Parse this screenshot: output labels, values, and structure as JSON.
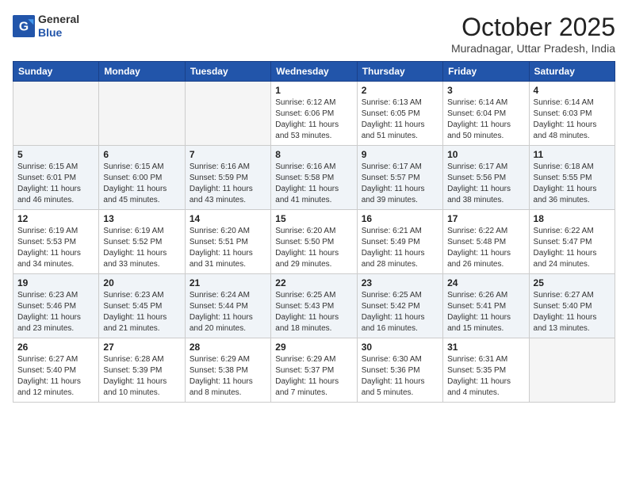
{
  "header": {
    "logo_general": "General",
    "logo_blue": "Blue",
    "month": "October 2025",
    "location": "Muradnagar, Uttar Pradesh, India"
  },
  "weekdays": [
    "Sunday",
    "Monday",
    "Tuesday",
    "Wednesday",
    "Thursday",
    "Friday",
    "Saturday"
  ],
  "weeks": [
    [
      {
        "day": "",
        "empty": true
      },
      {
        "day": "",
        "empty": true
      },
      {
        "day": "",
        "empty": true
      },
      {
        "day": "1",
        "lines": [
          "Sunrise: 6:12 AM",
          "Sunset: 6:06 PM",
          "Daylight: 11 hours",
          "and 53 minutes."
        ]
      },
      {
        "day": "2",
        "lines": [
          "Sunrise: 6:13 AM",
          "Sunset: 6:05 PM",
          "Daylight: 11 hours",
          "and 51 minutes."
        ]
      },
      {
        "day": "3",
        "lines": [
          "Sunrise: 6:14 AM",
          "Sunset: 6:04 PM",
          "Daylight: 11 hours",
          "and 50 minutes."
        ]
      },
      {
        "day": "4",
        "lines": [
          "Sunrise: 6:14 AM",
          "Sunset: 6:03 PM",
          "Daylight: 11 hours",
          "and 48 minutes."
        ]
      }
    ],
    [
      {
        "day": "5",
        "lines": [
          "Sunrise: 6:15 AM",
          "Sunset: 6:01 PM",
          "Daylight: 11 hours",
          "and 46 minutes."
        ]
      },
      {
        "day": "6",
        "lines": [
          "Sunrise: 6:15 AM",
          "Sunset: 6:00 PM",
          "Daylight: 11 hours",
          "and 45 minutes."
        ]
      },
      {
        "day": "7",
        "lines": [
          "Sunrise: 6:16 AM",
          "Sunset: 5:59 PM",
          "Daylight: 11 hours",
          "and 43 minutes."
        ]
      },
      {
        "day": "8",
        "lines": [
          "Sunrise: 6:16 AM",
          "Sunset: 5:58 PM",
          "Daylight: 11 hours",
          "and 41 minutes."
        ]
      },
      {
        "day": "9",
        "lines": [
          "Sunrise: 6:17 AM",
          "Sunset: 5:57 PM",
          "Daylight: 11 hours",
          "and 39 minutes."
        ]
      },
      {
        "day": "10",
        "lines": [
          "Sunrise: 6:17 AM",
          "Sunset: 5:56 PM",
          "Daylight: 11 hours",
          "and 38 minutes."
        ]
      },
      {
        "day": "11",
        "lines": [
          "Sunrise: 6:18 AM",
          "Sunset: 5:55 PM",
          "Daylight: 11 hours",
          "and 36 minutes."
        ]
      }
    ],
    [
      {
        "day": "12",
        "lines": [
          "Sunrise: 6:19 AM",
          "Sunset: 5:53 PM",
          "Daylight: 11 hours",
          "and 34 minutes."
        ]
      },
      {
        "day": "13",
        "lines": [
          "Sunrise: 6:19 AM",
          "Sunset: 5:52 PM",
          "Daylight: 11 hours",
          "and 33 minutes."
        ]
      },
      {
        "day": "14",
        "lines": [
          "Sunrise: 6:20 AM",
          "Sunset: 5:51 PM",
          "Daylight: 11 hours",
          "and 31 minutes."
        ]
      },
      {
        "day": "15",
        "lines": [
          "Sunrise: 6:20 AM",
          "Sunset: 5:50 PM",
          "Daylight: 11 hours",
          "and 29 minutes."
        ]
      },
      {
        "day": "16",
        "lines": [
          "Sunrise: 6:21 AM",
          "Sunset: 5:49 PM",
          "Daylight: 11 hours",
          "and 28 minutes."
        ]
      },
      {
        "day": "17",
        "lines": [
          "Sunrise: 6:22 AM",
          "Sunset: 5:48 PM",
          "Daylight: 11 hours",
          "and 26 minutes."
        ]
      },
      {
        "day": "18",
        "lines": [
          "Sunrise: 6:22 AM",
          "Sunset: 5:47 PM",
          "Daylight: 11 hours",
          "and 24 minutes."
        ]
      }
    ],
    [
      {
        "day": "19",
        "lines": [
          "Sunrise: 6:23 AM",
          "Sunset: 5:46 PM",
          "Daylight: 11 hours",
          "and 23 minutes."
        ]
      },
      {
        "day": "20",
        "lines": [
          "Sunrise: 6:23 AM",
          "Sunset: 5:45 PM",
          "Daylight: 11 hours",
          "and 21 minutes."
        ]
      },
      {
        "day": "21",
        "lines": [
          "Sunrise: 6:24 AM",
          "Sunset: 5:44 PM",
          "Daylight: 11 hours",
          "and 20 minutes."
        ]
      },
      {
        "day": "22",
        "lines": [
          "Sunrise: 6:25 AM",
          "Sunset: 5:43 PM",
          "Daylight: 11 hours",
          "and 18 minutes."
        ]
      },
      {
        "day": "23",
        "lines": [
          "Sunrise: 6:25 AM",
          "Sunset: 5:42 PM",
          "Daylight: 11 hours",
          "and 16 minutes."
        ]
      },
      {
        "day": "24",
        "lines": [
          "Sunrise: 6:26 AM",
          "Sunset: 5:41 PM",
          "Daylight: 11 hours",
          "and 15 minutes."
        ]
      },
      {
        "day": "25",
        "lines": [
          "Sunrise: 6:27 AM",
          "Sunset: 5:40 PM",
          "Daylight: 11 hours",
          "and 13 minutes."
        ]
      }
    ],
    [
      {
        "day": "26",
        "lines": [
          "Sunrise: 6:27 AM",
          "Sunset: 5:40 PM",
          "Daylight: 11 hours",
          "and 12 minutes."
        ]
      },
      {
        "day": "27",
        "lines": [
          "Sunrise: 6:28 AM",
          "Sunset: 5:39 PM",
          "Daylight: 11 hours",
          "and 10 minutes."
        ]
      },
      {
        "day": "28",
        "lines": [
          "Sunrise: 6:29 AM",
          "Sunset: 5:38 PM",
          "Daylight: 11 hours",
          "and 8 minutes."
        ]
      },
      {
        "day": "29",
        "lines": [
          "Sunrise: 6:29 AM",
          "Sunset: 5:37 PM",
          "Daylight: 11 hours",
          "and 7 minutes."
        ]
      },
      {
        "day": "30",
        "lines": [
          "Sunrise: 6:30 AM",
          "Sunset: 5:36 PM",
          "Daylight: 11 hours",
          "and 5 minutes."
        ]
      },
      {
        "day": "31",
        "lines": [
          "Sunrise: 6:31 AM",
          "Sunset: 5:35 PM",
          "Daylight: 11 hours",
          "and 4 minutes."
        ]
      },
      {
        "day": "",
        "empty": true
      }
    ]
  ]
}
